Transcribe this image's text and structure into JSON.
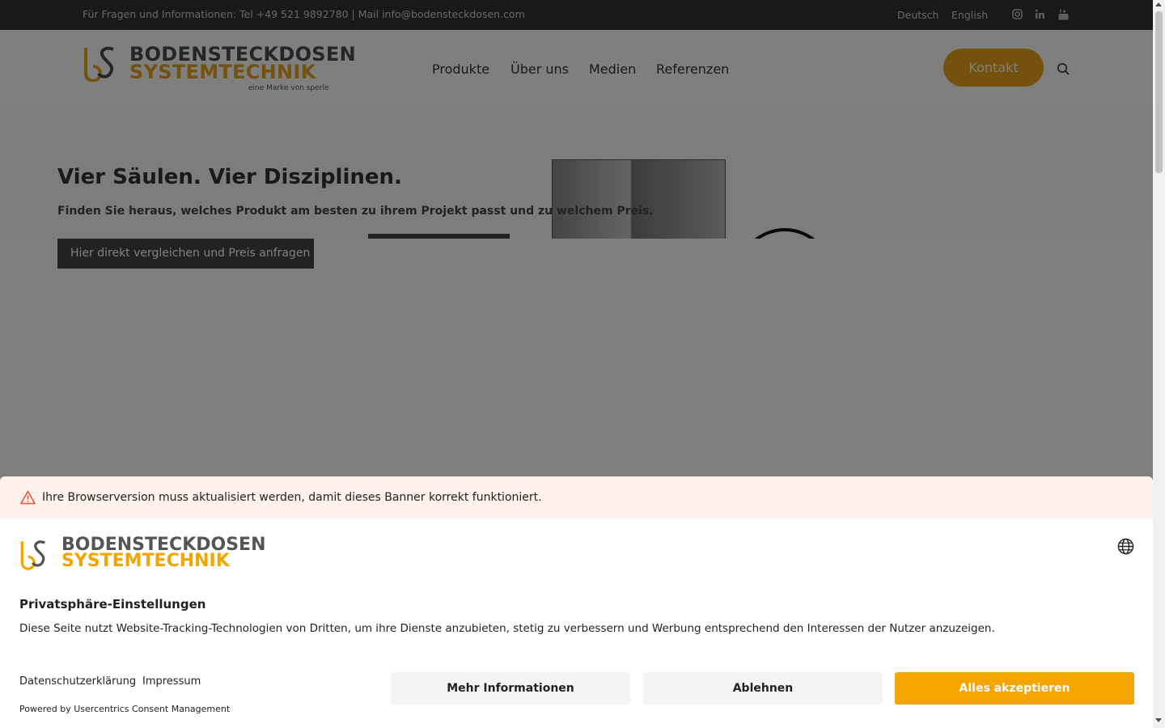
{
  "topbar": {
    "contact_text": "Für Fragen und Informationen: Tel +49 521 9892780 | Mail info@bodensteckdosen.com",
    "languages": [
      "Deutsch",
      "English"
    ],
    "social_icons": [
      "instagram-icon",
      "linkedin-icon",
      "youtube-icon"
    ]
  },
  "header": {
    "logo": {
      "line1": "BODENSTECKDOSEN",
      "line2": "SYSTEMTECHNIK",
      "sub": "eine Marke von sperle"
    },
    "nav": [
      "Produkte",
      "Über uns",
      "Medien",
      "Referenzen"
    ],
    "kontakt_label": "Kontakt",
    "search_icon": "search-icon"
  },
  "hero": {
    "title": "Vier Säulen. Vier Disziplinen.",
    "subtitle": "Finden Sie heraus, welches Produkt am besten zu ihrem Projekt passt und zu welchem Preis.",
    "button_label": "Hier direkt vergleichen und Preis anfragen"
  },
  "consent": {
    "warning_text": "Ihre Browserversion muss aktualisiert werden, damit dieses Banner korrekt funktioniert.",
    "logo_line1": "BODENSTECKDOSEN",
    "logo_line2": "SYSTEMTECHNIK",
    "title": "Privatsphäre-Einstellungen",
    "description": "Diese Seite nutzt Website-Tracking-Technologien von Dritten, um ihre Dienste anzubieten, stetig zu verbessern und Werbung entsprechend den Interessen der Nutzer anzuzeigen.",
    "links": [
      "Datenschutzerklärung",
      "Impressum"
    ],
    "powered_by": "Powered by Usercentrics Consent Management",
    "buttons": {
      "more": "Mehr Informationen",
      "deny": "Ablehnen",
      "accept": "Alles akzeptieren"
    },
    "colors": {
      "accent": "#f5a500",
      "warning_bg": "#fff1ec"
    }
  },
  "brand_colors": {
    "gold": "#e8a318",
    "dark": "#333333"
  }
}
